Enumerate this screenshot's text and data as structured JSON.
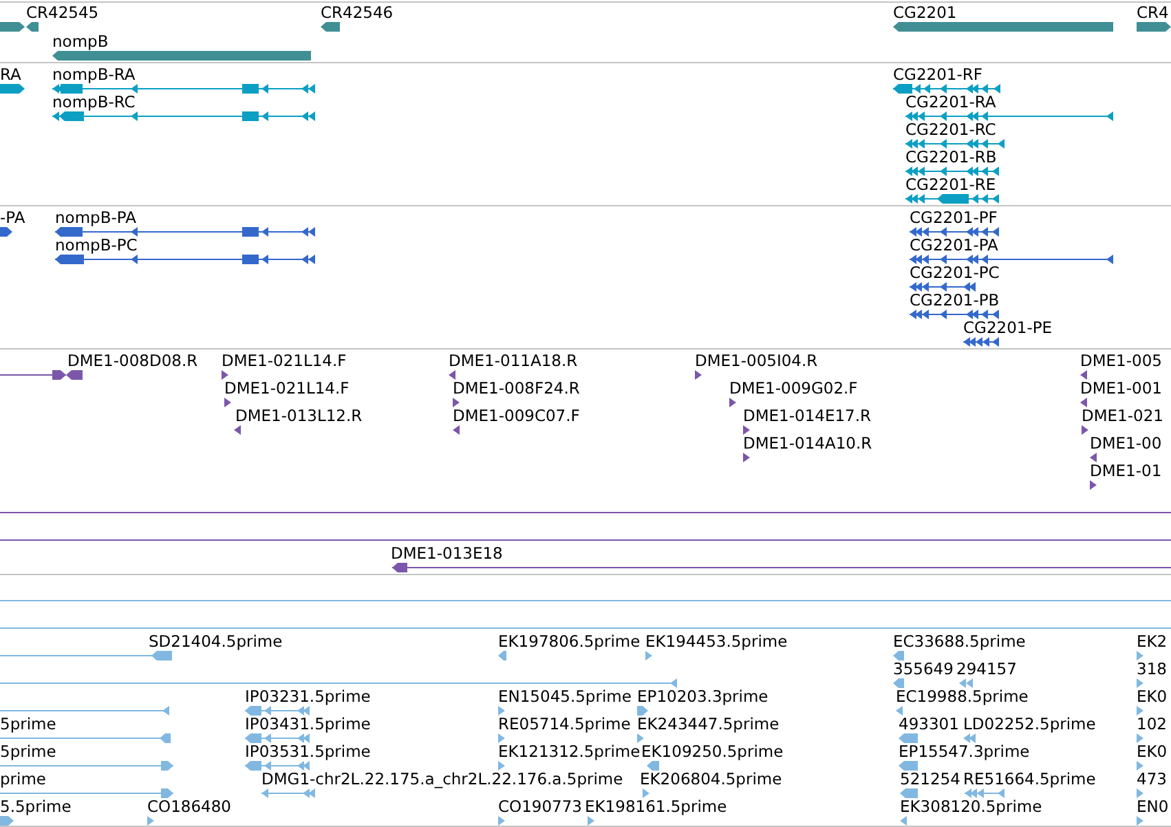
{
  "tracks": [
    {
      "kind": "gene",
      "features": [
        {
          "reverse": false
        },
        {
          "label": "CR42545",
          "reverse": true
        },
        {
          "label": "CR42546",
          "reverse": true
        },
        {
          "label": "nompB",
          "reverse": true
        },
        {
          "label": "CG2201",
          "reverse": true
        },
        {
          "label": "CR4",
          "reverse": false
        }
      ]
    },
    {
      "kind": "mrna",
      "features": [
        {
          "label": "RA",
          "reverse": false
        },
        {
          "label": "nompB-RA",
          "reverse": true
        },
        {
          "label": "nompB-RC",
          "reverse": true
        },
        {
          "label": "CG2201-RF",
          "reverse": true
        },
        {
          "label": "CG2201-RA",
          "reverse": true
        },
        {
          "label": "CG2201-RC",
          "reverse": true
        },
        {
          "label": "CG2201-RB",
          "reverse": true
        },
        {
          "label": "CG2201-RE",
          "reverse": true
        }
      ]
    },
    {
      "kind": "protein",
      "features": [
        {
          "label": "-PA",
          "reverse": false
        },
        {
          "label": "nompB-PA",
          "reverse": true
        },
        {
          "label": "nompB-PC",
          "reverse": true
        },
        {
          "label": "CG2201-PF",
          "reverse": true
        },
        {
          "label": "CG2201-PA",
          "reverse": true
        },
        {
          "label": "CG2201-PC",
          "reverse": true
        },
        {
          "label": "CG2201-PB",
          "reverse": true
        },
        {
          "label": "CG2201-PE",
          "reverse": true
        }
      ]
    },
    {
      "kind": "bac_end",
      "features": [
        {
          "reverse": false
        },
        {
          "label": "DME1-008D08.R",
          "reverse": true
        },
        {
          "label": "DME1-021L14.F",
          "reverse": false
        },
        {
          "label": "DME1-021L14.F",
          "reverse": false
        },
        {
          "label": "DME1-013L12.R",
          "reverse": true
        },
        {
          "label": "DME1-011A18.R",
          "reverse": true
        },
        {
          "label": "DME1-008F24.R",
          "reverse": false
        },
        {
          "label": "DME1-009C07.F",
          "reverse": true
        },
        {
          "label": "DME1-005I04.R",
          "reverse": false
        },
        {
          "label": "DME1-009G02.F",
          "reverse": false
        },
        {
          "label": "DME1-014E17.R",
          "reverse": false
        },
        {
          "label": "DME1-014A10.R",
          "reverse": false
        },
        {
          "label": "DME1-005",
          "reverse": true
        },
        {
          "label": "DME1-001",
          "reverse": true
        },
        {
          "label": "DME1-021",
          "reverse": false
        },
        {
          "label": "DME1-00",
          "reverse": true
        },
        {
          "label": "DME1-01",
          "reverse": false
        },
        {
          "label": "DME1-013E18",
          "reverse": true
        }
      ]
    },
    {
      "kind": "est",
      "features": [
        {
          "label": "SD21404.5prime",
          "reverse": true
        },
        {
          "label": "EK197806.5prime",
          "reverse": true
        },
        {
          "label": "EK194453.5prime",
          "reverse": false
        },
        {
          "label": "EC33688.5prime",
          "reverse": true
        },
        {
          "label": "EK2",
          "reverse": false
        },
        {
          "reverse": true
        },
        {
          "label": "355649",
          "reverse": true
        },
        {
          "label": "294157",
          "reverse": true
        },
        {
          "label": "318",
          "reverse": false
        },
        {
          "reverse": true
        },
        {
          "label": "IP03231.5prime",
          "reverse": true
        },
        {
          "label": "EN15045.5prime",
          "reverse": false
        },
        {
          "label": "EP10203.3prime",
          "reverse": false
        },
        {
          "label": "EC19988.5prime",
          "reverse": true
        },
        {
          "label": "EK0",
          "reverse": false
        },
        {
          "label": "5prime",
          "reverse": true
        },
        {
          "label": "IP03431.5prime",
          "reverse": true
        },
        {
          "label": "RE05714.5prime",
          "reverse": false
        },
        {
          "label": "EK243447.5prime",
          "reverse": false
        },
        {
          "label": "493301",
          "reverse": true
        },
        {
          "label": "LD02252.5prime",
          "reverse": true
        },
        {
          "label": "102",
          "reverse": false
        },
        {
          "label": "5prime",
          "reverse": false
        },
        {
          "label": "IP03531.5prime",
          "reverse": true
        },
        {
          "label": "EK121312.5prime",
          "reverse": false
        },
        {
          "label": "EK109250.5prime",
          "reverse": true
        },
        {
          "label": "EP15547.3prime",
          "reverse": true
        },
        {
          "label": "EK0",
          "reverse": false
        },
        {
          "label": "prime",
          "reverse": false
        },
        {
          "label": "DMG1-chr2L.22.175.a_chr2L.22.176.a.5prime",
          "reverse": true
        },
        {
          "label": "EK206804.5prime",
          "reverse": false
        },
        {
          "label": "521254",
          "reverse": true
        },
        {
          "label": "RE51664.5prime",
          "reverse": true
        },
        {
          "label": "473",
          "reverse": false
        },
        {
          "label": "5.5prime",
          "reverse": false
        },
        {
          "label": "CO186480",
          "reverse": false
        },
        {
          "label": "CO190773",
          "reverse": false
        },
        {
          "label": "EK198161.5prime",
          "reverse": false
        },
        {
          "label": "EK308120.5prime",
          "reverse": true
        },
        {
          "label": "EN0",
          "reverse": false
        }
      ]
    }
  ]
}
